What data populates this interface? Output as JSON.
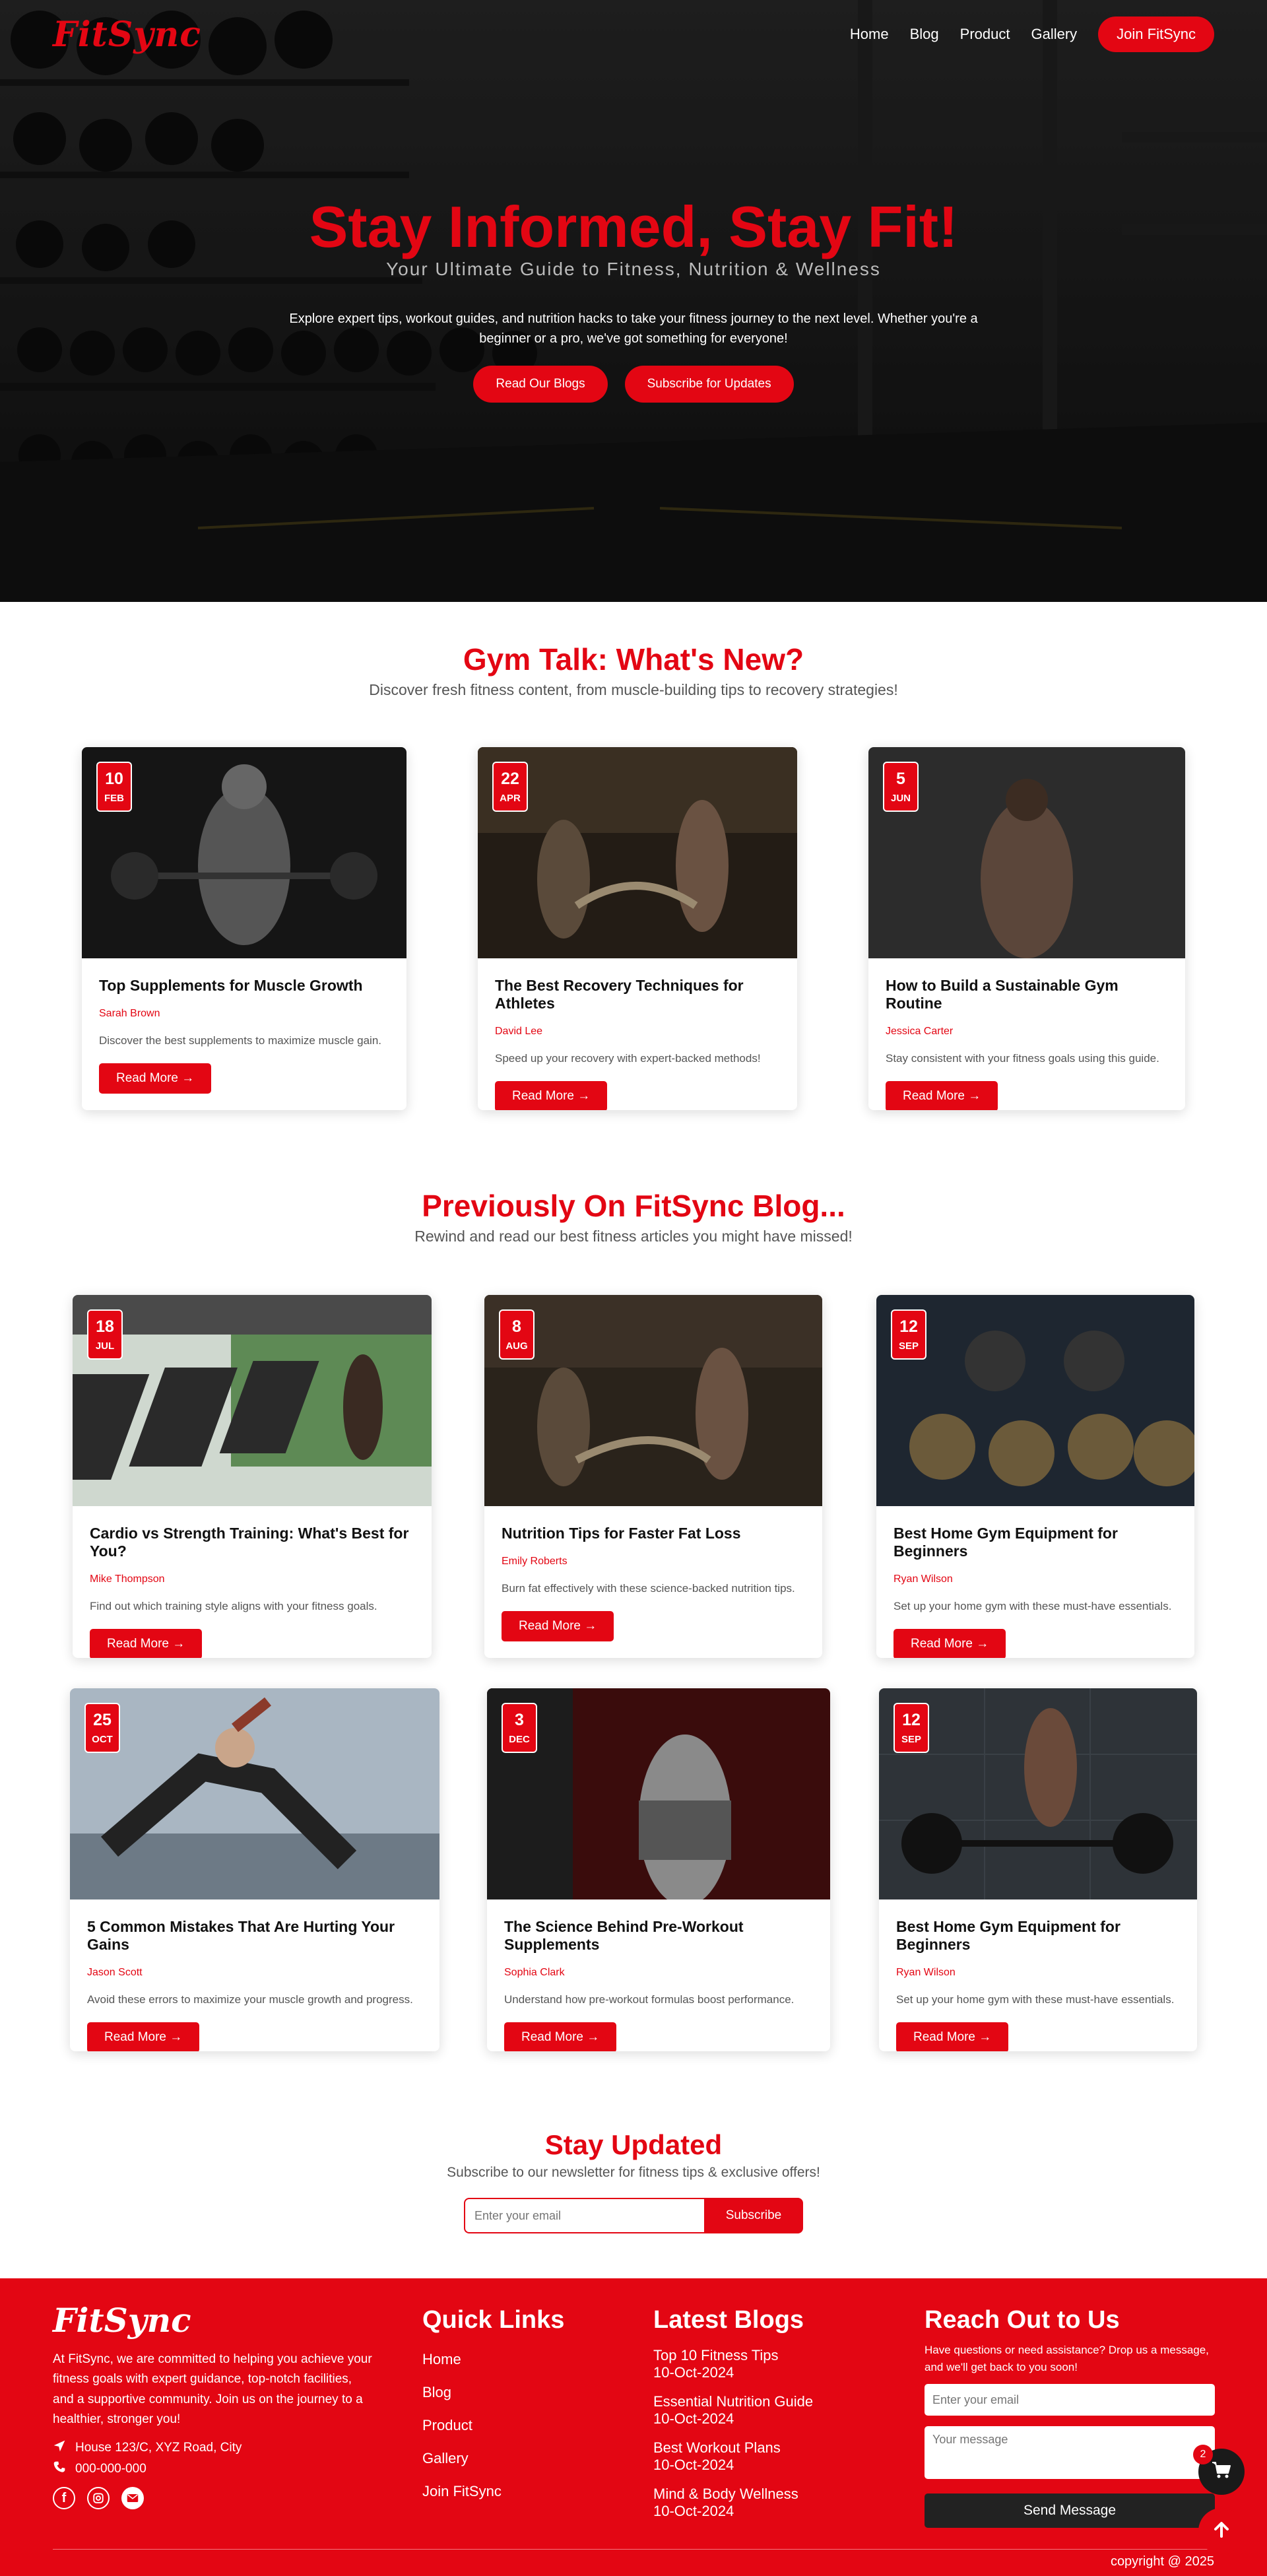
{
  "brand": "FitSync",
  "nav": {
    "links": [
      "Home",
      "Blog",
      "Product",
      "Gallery"
    ],
    "cta": "Join FitSync"
  },
  "hero": {
    "title": "Stay Informed, Stay Fit!",
    "subtitle": "Your Ultimate Guide to Fitness, Nutrition & Wellness",
    "description": "Explore expert tips, workout guides, and nutrition hacks to take your fitness journey to the next level. Whether you're a beginner or a pro, we've got something for everyone!",
    "btn_read": "Read Our Blogs",
    "btn_subscribe": "Subscribe for Updates"
  },
  "gym_talk": {
    "title": "Gym Talk: What's New?",
    "subtitle": "Discover fresh fitness content, from muscle-building tips to recovery strategies!",
    "cards": [
      {
        "day": "10",
        "month": "FEB",
        "title": "Top Supplements for Muscle Growth",
        "author": "Sarah Brown",
        "excerpt": "Discover the best supplements to maximize muscle gain.",
        "btn": "Read More →"
      },
      {
        "day": "22",
        "month": "APR",
        "title": "The Best Recovery Techniques for Athletes",
        "author": "David Lee",
        "excerpt": "Speed up your recovery with expert-backed methods!",
        "btn": "Read More →"
      },
      {
        "day": "5",
        "month": "JUN",
        "title": "How to Build a Sustainable Gym Routine",
        "author": "Jessica Carter",
        "excerpt": "Stay consistent with your fitness goals using this guide.",
        "btn": "Read More →"
      }
    ]
  },
  "previous": {
    "title": "Previously On FitSync Blog...",
    "subtitle": "Rewind and read our best fitness articles you might have missed!",
    "cards": [
      {
        "day": "18",
        "month": "JUL",
        "title": "Cardio vs Strength Training: What's Best for You?",
        "author": "Mike Thompson",
        "excerpt": "Find out which training style aligns with your fitness goals.",
        "btn": "Read More →"
      },
      {
        "day": "8",
        "month": "AUG",
        "title": "Nutrition Tips for Faster Fat Loss",
        "author": "Emily Roberts",
        "excerpt": "Burn fat effectively with these science-backed nutrition tips.",
        "btn": "Read More →"
      },
      {
        "day": "12",
        "month": "SEP",
        "title": "Best Home Gym Equipment for Beginners",
        "author": "Ryan Wilson",
        "excerpt": "Set up your home gym with these must-have essentials.",
        "btn": "Read More →"
      },
      {
        "day": "25",
        "month": "OCT",
        "title": "5 Common Mistakes That Are Hurting Your Gains",
        "author": "Jason Scott",
        "excerpt": "Avoid these errors to maximize your muscle growth and progress.",
        "btn": "Read More →"
      },
      {
        "day": "3",
        "month": "DEC",
        "title": "The Science Behind Pre-Workout Supplements",
        "author": "Sophia Clark",
        "excerpt": "Understand how pre-workout formulas boost performance.",
        "btn": "Read More →"
      },
      {
        "day": "12",
        "month": "SEP",
        "title": "Best Home Gym Equipment for Beginners",
        "author": "Ryan Wilson",
        "excerpt": "Set up your home gym with these must-have essentials.",
        "btn": "Read More →"
      }
    ]
  },
  "newsletter": {
    "title": "Stay Updated",
    "subtitle": "Subscribe to our newsletter for fitness tips & exclusive offers!",
    "placeholder": "Enter your email",
    "button": "Subscribe"
  },
  "footer": {
    "about": "At FitSync, we are committed to helping you achieve your fitness goals with expert guidance, top-notch facilities, and a supportive community. Join us on the journey to a healthier, stronger you!",
    "address": "House 123/C, XYZ Road, City",
    "phone": "000-000-000",
    "quick_links_title": "Quick Links",
    "quick_links": [
      "Home",
      "Blog",
      "Product",
      "Gallery",
      "Join FitSync"
    ],
    "latest_blogs_title": "Latest Blogs",
    "latest_blogs": [
      {
        "title": "Top 10 Fitness Tips",
        "date": "10-Oct-2024"
      },
      {
        "title": "Essential Nutrition Guide",
        "date": "10-Oct-2024"
      },
      {
        "title": "Best Workout Plans",
        "date": "10-Oct-2024"
      },
      {
        "title": "Mind & Body Wellness",
        "date": "10-Oct-2024"
      }
    ],
    "reach_title": "Reach Out to Us",
    "reach_text": "Have questions or need assistance? Drop us a message, and we'll get back to you soon!",
    "email_placeholder": "Enter your email",
    "message_placeholder": "Your message",
    "send": "Send Message",
    "copyright": "copyright @ 2025"
  },
  "cart": {
    "count": "2"
  },
  "colors": {
    "accent": "#e30613",
    "dark": "#1a1a1a"
  },
  "icons": [
    "location-icon",
    "phone-icon",
    "facebook-icon",
    "instagram-icon",
    "email-icon",
    "cart-icon",
    "arrow-up-icon"
  ]
}
